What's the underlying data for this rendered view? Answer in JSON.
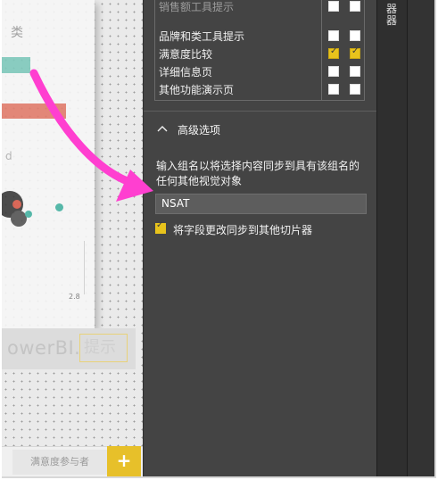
{
  "canvas": {
    "card_title": "类",
    "d_label": "d",
    "tick_label": "2.8",
    "powerbi_text": "owerBI.",
    "powerbi_tip": "提示",
    "colors": {
      "teal": "#7fc9bc",
      "coral": "#e27d6c",
      "bubble_dark": "#3b3b3b",
      "bubble_red": "#d75a4a",
      "bubble_teal": "#47b3a3"
    }
  },
  "tabs": {
    "page_tab_label": "满意度参与者",
    "add_icon": "plus-icon",
    "add_symbol": "+"
  },
  "format_panel": {
    "matrix_rows": [
      {
        "label": "销售额工具提示",
        "col1": false,
        "col2": false,
        "dim": true
      },
      {
        "label": "品牌和类工具提示",
        "col1": false,
        "col2": false,
        "dim": false
      },
      {
        "label": "满意度比较",
        "col1": true,
        "col2": true,
        "dim": false
      },
      {
        "label": "详细信息页",
        "col1": false,
        "col2": false,
        "dim": false
      },
      {
        "label": "其他功能演示页",
        "col1": false,
        "col2": false,
        "dim": false
      }
    ],
    "advanced": {
      "title": "高级选项",
      "description": "输入组名以将选择内容同步到具有该组名的任何其他视觉对象",
      "group_name_value": "NSAT",
      "sync_field_label": "将字段更改同步到其他切片器",
      "sync_field_checked": true
    },
    "accent_color": "#e8c31c"
  },
  "side_pane": {
    "label": "器器"
  },
  "annotation": {
    "arrow_color": "#ff3fd0"
  }
}
